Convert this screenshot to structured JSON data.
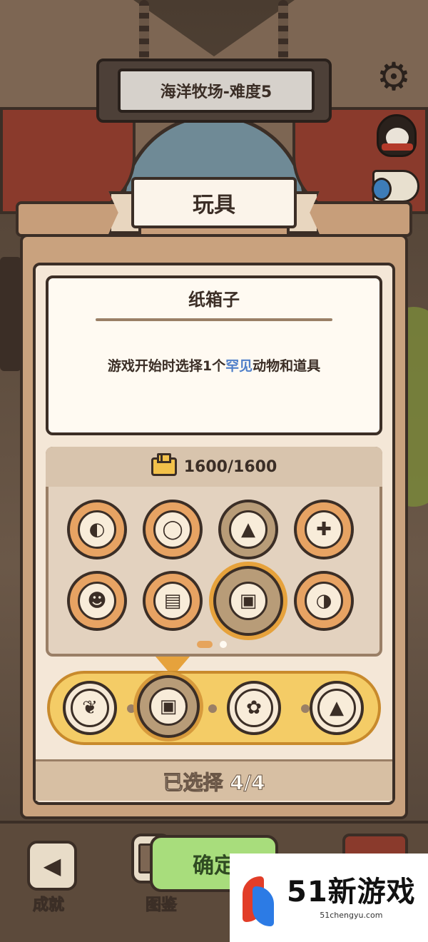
{
  "header": {
    "level_title": "海洋牧场-难度5"
  },
  "panel": {
    "title": "玩具"
  },
  "item_detail": {
    "name": "纸箱子",
    "desc_before": "游戏开始时选择1个",
    "desc_highlight": "罕见",
    "desc_after": "动物和道具",
    "highlight_color": "#4f7fc9"
  },
  "budget": {
    "value": "1600/1600",
    "icon": "coin-bricks-icon"
  },
  "items": [
    {
      "name": "cat-bowl-item",
      "icon": "cat-bowl-icon",
      "glyph": "◐",
      "state": "owned"
    },
    {
      "name": "collar-item",
      "icon": "collar-icon",
      "glyph": "◯",
      "state": "owned"
    },
    {
      "name": "plunger-toy-item",
      "icon": "plunger-toy-icon",
      "glyph": "▲",
      "state": "selected"
    },
    {
      "name": "game-console-item",
      "icon": "game-console-icon",
      "glyph": "✚",
      "state": "owned"
    },
    {
      "name": "cat-doll-item",
      "icon": "cat-doll-icon",
      "glyph": "☻",
      "state": "owned"
    },
    {
      "name": "cat-tree-item",
      "icon": "cat-tree-icon",
      "glyph": "▤",
      "state": "owned"
    },
    {
      "name": "cardboard-box-item",
      "icon": "cardboard-box-icon",
      "glyph": "▣",
      "state": "focused"
    },
    {
      "name": "beach-ball-item",
      "icon": "beach-ball-icon",
      "glyph": "◑",
      "state": "owned"
    }
  ],
  "pagination": {
    "current": 1,
    "total": 2
  },
  "tray": {
    "slots": [
      {
        "icon": "yellow-fish-icon",
        "glyph": "❦"
      },
      {
        "icon": "cardboard-box-icon",
        "glyph": "▣"
      },
      {
        "icon": "goldfish-icon",
        "glyph": "✿"
      },
      {
        "icon": "plunger-toy-icon",
        "glyph": "▲"
      }
    ],
    "selected_label": "已选择 4/4"
  },
  "bottom_nav": {
    "achievements_label": "成就",
    "confirm_label": "确定",
    "collection_label": "图鉴"
  },
  "watermark": {
    "brand": "51新游戏",
    "url": "51chengyu.com"
  },
  "colors": {
    "accent_orange": "#e6a23c",
    "confirm_green": "#a8dd7c",
    "panel_brown": "#c9a27e"
  }
}
